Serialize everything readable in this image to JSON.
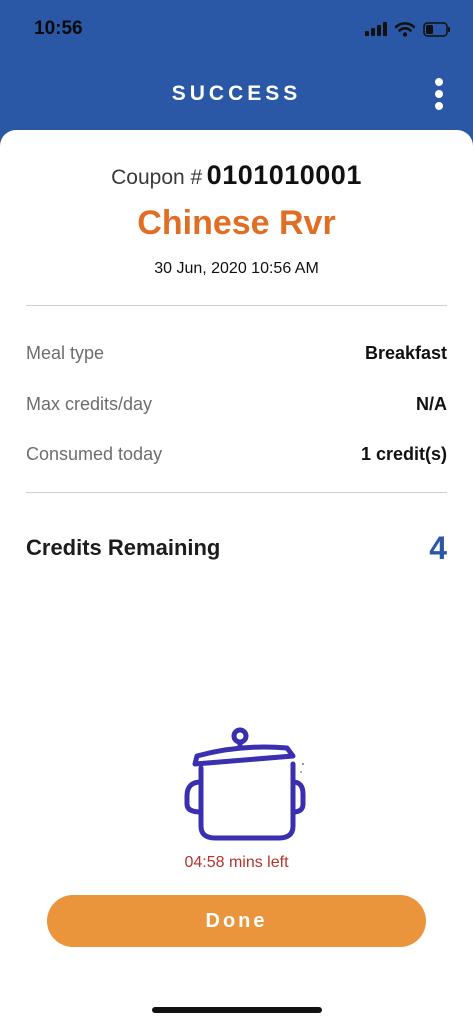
{
  "status_bar": {
    "time": "10:56",
    "icons": [
      "cellular-signal-icon",
      "wifi-icon",
      "battery-icon"
    ]
  },
  "header": {
    "title": "SUCCESS",
    "menu_icon": "kebab-menu-icon"
  },
  "coupon": {
    "label": "Coupon #",
    "number": "0101010001",
    "vendor": "Chinese Rvr",
    "timestamp": "30 Jun, 2020 10:56 AM"
  },
  "details": [
    {
      "label": "Meal type",
      "value": "Breakfast"
    },
    {
      "label": "Max credits/day",
      "value": "N/A"
    },
    {
      "label": "Consumed today",
      "value": "1 credit(s)"
    }
  ],
  "credits": {
    "label": "Credits Remaining",
    "value": "4"
  },
  "illustration": "cooking-pot-icon",
  "timer": "04:58 mins left",
  "done_label": "Done",
  "colors": {
    "header_blue": "#2b58a6",
    "vendor_orange": "#e06e25",
    "button_orange": "#ea943b",
    "pot_stroke": "#3a2fae",
    "timer_red": "#b4332a"
  }
}
